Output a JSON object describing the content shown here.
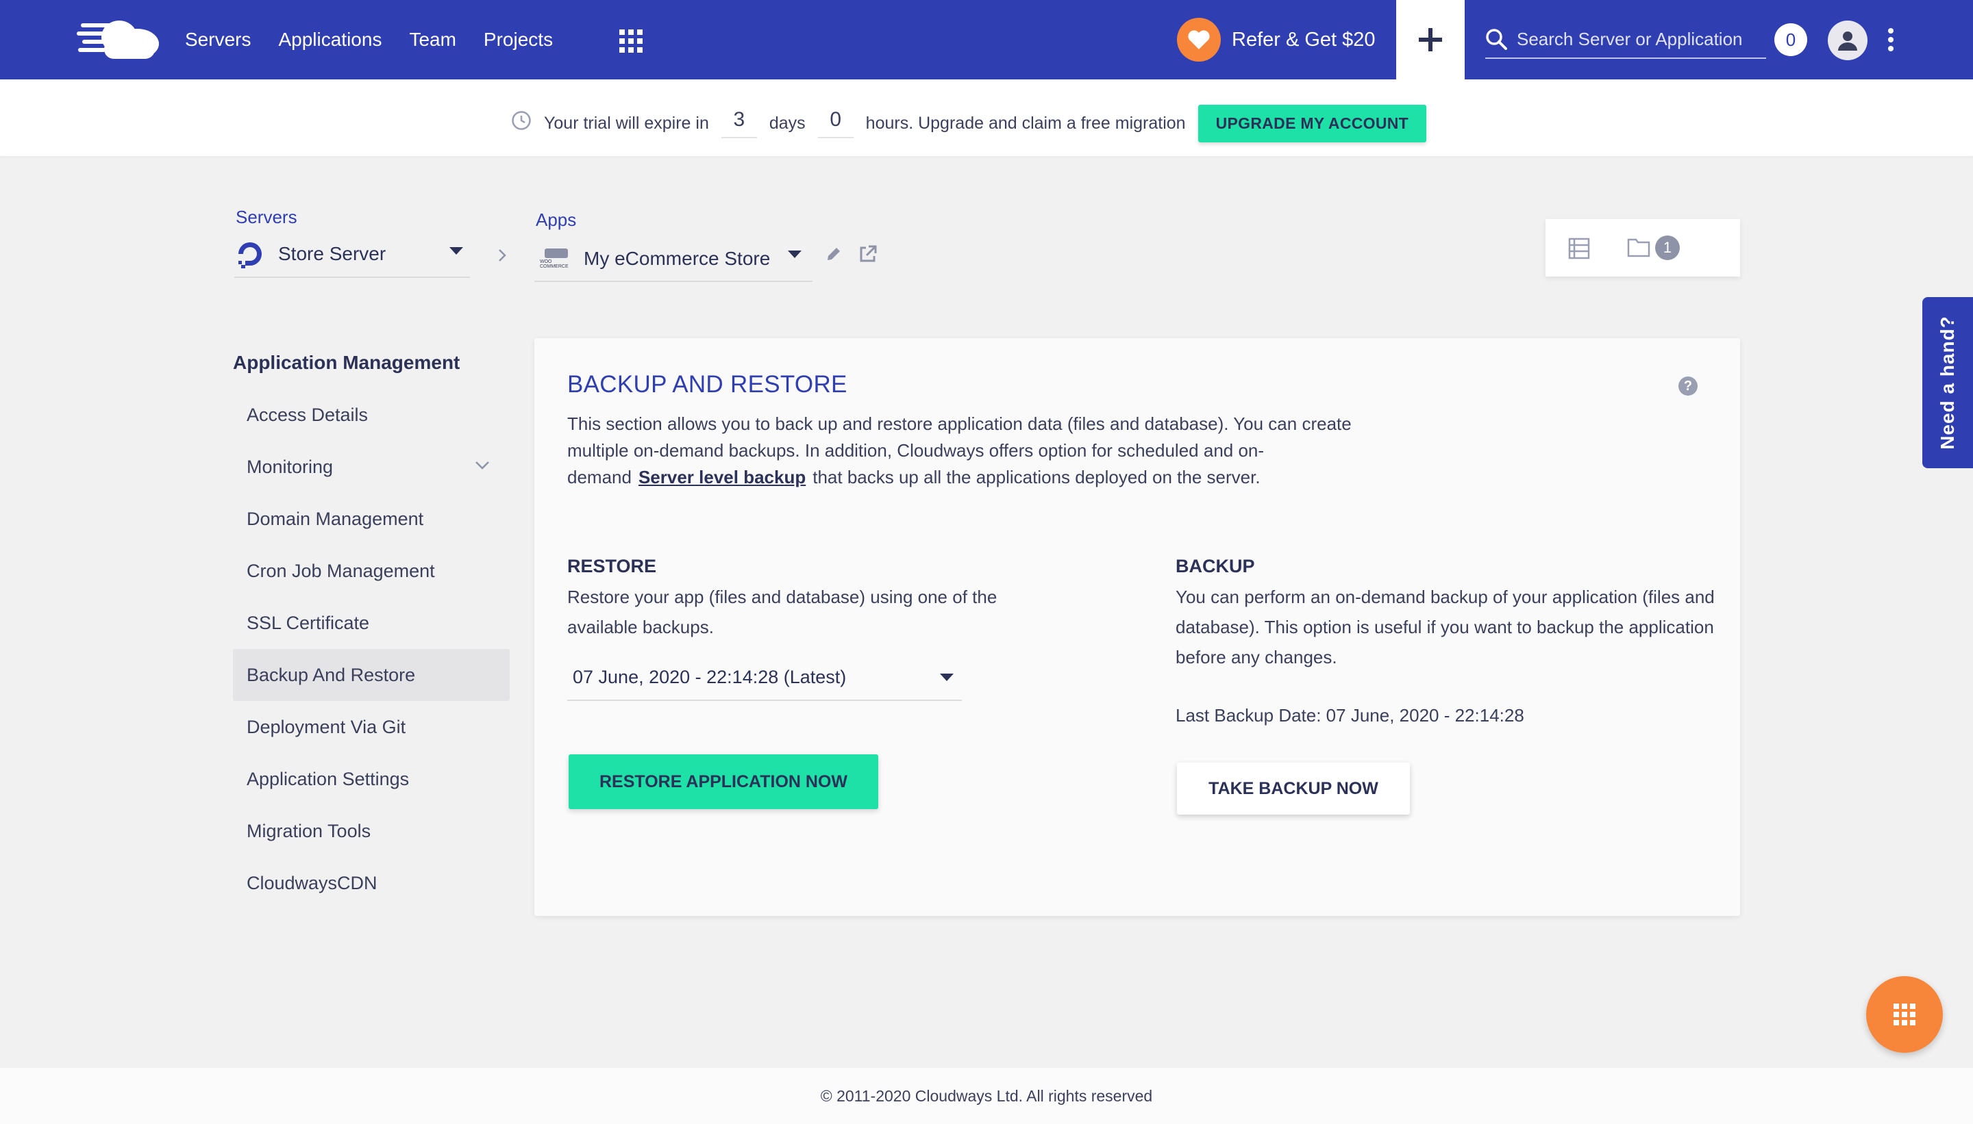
{
  "header": {
    "nav": [
      "Servers",
      "Applications",
      "Team",
      "Projects"
    ],
    "refer_label": "Refer & Get $20",
    "search_placeholder": "Search Server or Application",
    "notification_count": "0",
    "brand_color": "#2f3eb1",
    "accent_color": "#f7863a"
  },
  "trial": {
    "prefix": "Your trial will expire in",
    "days_value": "3",
    "days_label": "days",
    "hours_value": "0",
    "suffix": "hours. Upgrade and claim a free migration",
    "upgrade_button": "UPGRADE MY ACCOUNT",
    "button_color": "#1ee1a7"
  },
  "breadcrumb": {
    "servers_label": "Servers",
    "server_name": "Store Server",
    "apps_label": "Apps",
    "app_name": "My eCommerce Store",
    "app_icon_text": "WOO COMMERCE"
  },
  "toolbar": {
    "file_badge_count": "1"
  },
  "sidebar": {
    "title": "Application Management",
    "items": [
      {
        "label": "Access Details"
      },
      {
        "label": "Monitoring"
      },
      {
        "label": "Domain Management"
      },
      {
        "label": "Cron Job Management"
      },
      {
        "label": "SSL Certificate"
      },
      {
        "label": "Backup And Restore"
      },
      {
        "label": "Deployment Via Git"
      },
      {
        "label": "Application Settings"
      },
      {
        "label": "Migration Tools"
      },
      {
        "label": "CloudwaysCDN"
      }
    ],
    "active_item": "Backup And Restore"
  },
  "card": {
    "title": "BACKUP AND RESTORE",
    "desc_part1": "This section allows you to back up and restore application data (files and database). You can create multiple on-demand backups. In addition, Cloudways offers option for scheduled and on-demand",
    "desc_link": "Server level backup",
    "desc_part2": "that backs up all the applications deployed on the server.",
    "restore": {
      "heading": "RESTORE",
      "text": "Restore your app (files and database) using one of the available backups.",
      "selected_backup": "07 June, 2020 - 22:14:28 (Latest)",
      "button": "RESTORE APPLICATION NOW"
    },
    "backup": {
      "heading": "BACKUP",
      "text": "You can perform an on-demand backup of your application (files and database). This option is useful if you want to backup the application before any changes.",
      "last_backup": "Last Backup Date: 07 June, 2020 - 22:14:28",
      "button": "TAKE BACKUP NOW"
    }
  },
  "help_tab": "Need a hand?",
  "footer": "© 2011-2020 Cloudways Ltd. All rights reserved"
}
